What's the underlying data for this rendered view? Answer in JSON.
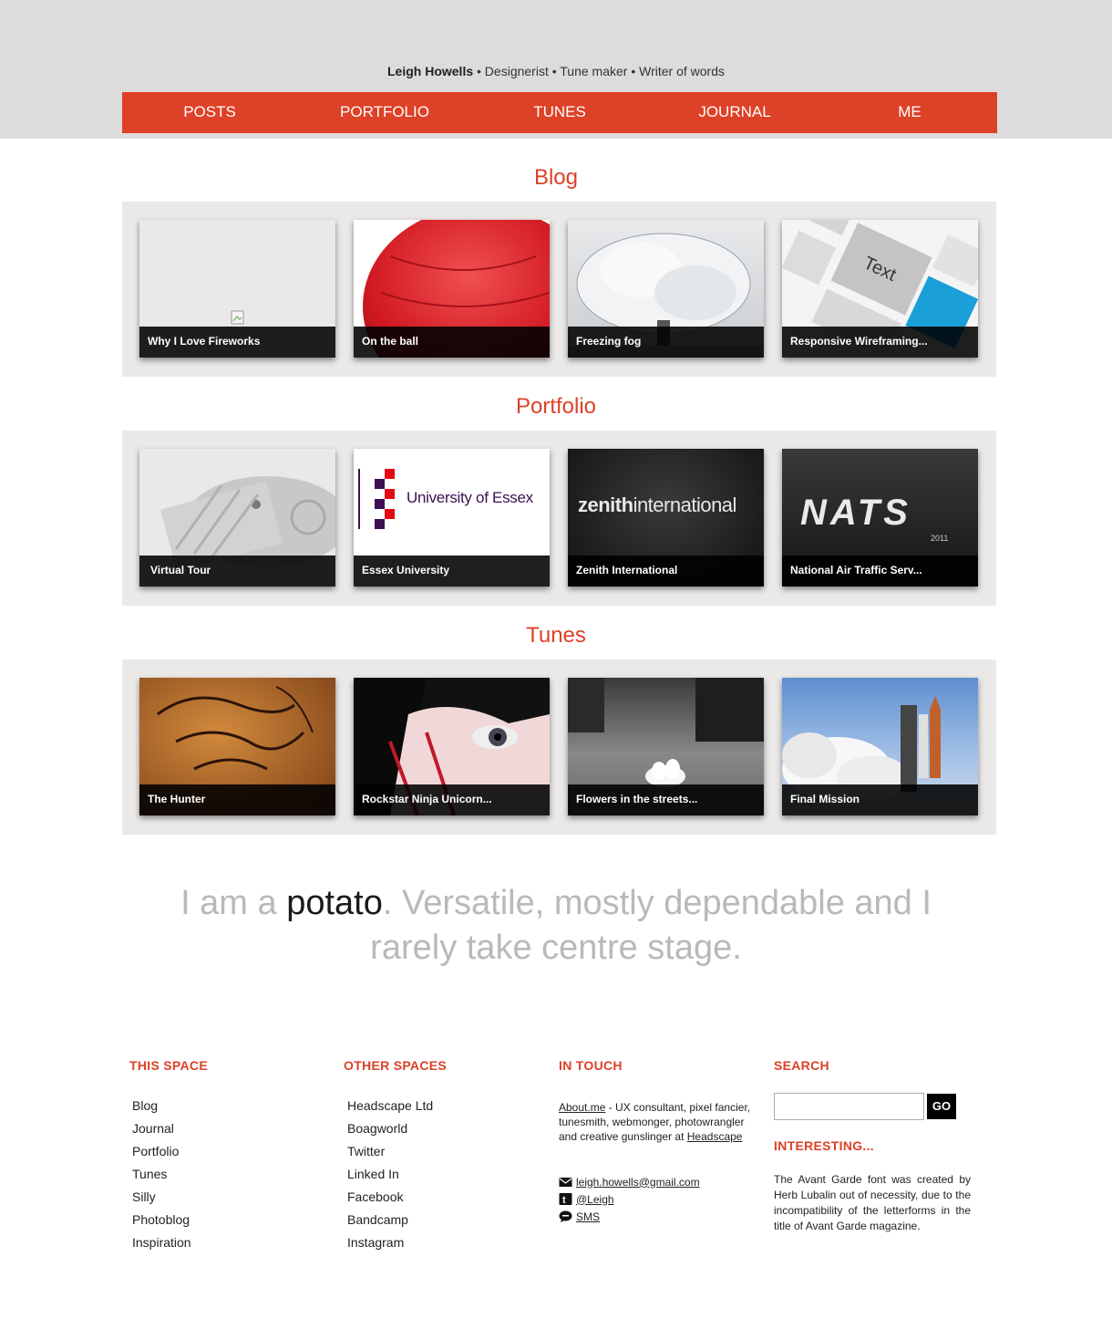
{
  "header": {
    "name": "Leigh Howells",
    "tagline": " • Designerist • Tune maker • Writer of words"
  },
  "nav": [
    "POSTS",
    "PORTFOLIO",
    "TUNES",
    "JOURNAL",
    "ME"
  ],
  "sections": {
    "blog": {
      "title": "Blog",
      "cards": [
        {
          "caption": "Why I Love Fireworks",
          "image": "broken-image-icon"
        },
        {
          "caption": "On the ball",
          "image": "red-ball"
        },
        {
          "caption": "Freezing fog",
          "image": "frosted-tree"
        },
        {
          "caption": "Responsive Wireframing...",
          "image": "wireframe-boxes"
        }
      ]
    },
    "portfolio": {
      "title": "Portfolio",
      "cards": [
        {
          "caption": "Virtual Tour",
          "image": "steam-engine"
        },
        {
          "caption": "Essex University",
          "image": "university-logo",
          "logo": "University of Essex"
        },
        {
          "caption": "Zenith International",
          "image": "zenith-logo",
          "logo_bold": "zenith",
          "logo_rest": "international"
        },
        {
          "caption": "National Air Traffic Serv...",
          "image": "nats-logo",
          "logo": "NATS",
          "logo_year": "2011"
        }
      ]
    },
    "tunes": {
      "title": "Tunes",
      "cards": [
        {
          "caption": "The Hunter",
          "image": "cave-painting"
        },
        {
          "caption": "Rockstar Ninja Unicorn...",
          "image": "eye-closeup"
        },
        {
          "caption": "Flowers in the streets...",
          "image": "street-flower"
        },
        {
          "caption": "Final Mission",
          "image": "shuttle-launch"
        }
      ]
    }
  },
  "quote": {
    "before": "I am a ",
    "highlight": "potato",
    "after": ". Versatile, mostly dependable and I rarely take centre stage."
  },
  "footer": {
    "this_space": {
      "heading": "THIS SPACE",
      "links": [
        "Blog",
        "Journal",
        "Portfolio",
        "Tunes",
        "Silly",
        "Photoblog",
        "Inspiration"
      ]
    },
    "other_spaces": {
      "heading": "OTHER SPACES",
      "links": [
        "Headscape Ltd",
        "Boagworld",
        "Twitter",
        "Linked In",
        "Facebook",
        "Bandcamp",
        "Instagram"
      ]
    },
    "in_touch": {
      "heading": "IN TOUCH",
      "about_link": "About.me",
      "about_text": " - UX consultant, pixel fancier, tunesmith, webmonger, photowrangler and creative gunslinger at ",
      "company_link": "Headscape",
      "email": "leigh.howells@gmail.com",
      "twitter": "@Leigh",
      "sms": "SMS"
    },
    "search": {
      "heading": "SEARCH",
      "button": "GO",
      "placeholder": ""
    },
    "interesting": {
      "heading": "INTERESTING...",
      "text": "The Avant Garde font was created by Herb Lubalin out of necessity, due to the incompatibility of the letterforms in the title of Avant Garde magazine."
    }
  },
  "colors": {
    "accent": "#dd4127",
    "band": "#dcdcdc",
    "panel": "#ebe8e8"
  }
}
